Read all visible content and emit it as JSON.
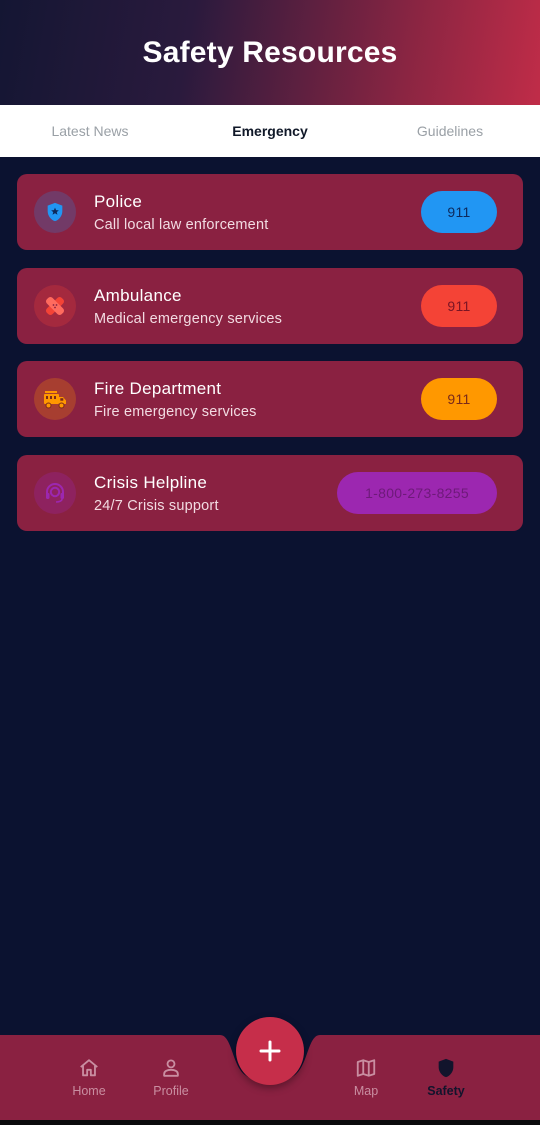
{
  "header": {
    "title": "Safety Resources"
  },
  "tabs": [
    {
      "label": "Latest News",
      "active": false
    },
    {
      "label": "Emergency",
      "active": true
    },
    {
      "label": "Guidelines",
      "active": false
    }
  ],
  "contacts": [
    {
      "title": "Police",
      "subtitle": "Call local law enforcement",
      "number": "911",
      "icon": "police-shield-icon",
      "color": "#2196f3"
    },
    {
      "title": "Ambulance",
      "subtitle": "Medical emergency services",
      "number": "911",
      "icon": "bandage-icon",
      "color": "#f44336"
    },
    {
      "title": "Fire Department",
      "subtitle": "Fire emergency services",
      "number": "911",
      "icon": "fire-truck-icon",
      "color": "#ff9800"
    },
    {
      "title": "Crisis Helpline",
      "subtitle": "24/7 Crisis support",
      "number": "1-800-273-8255",
      "icon": "support-agent-icon",
      "color": "#9c27b0"
    }
  ],
  "nav": [
    {
      "label": "Home",
      "icon": "home-icon",
      "active": false
    },
    {
      "label": "Profile",
      "icon": "person-icon",
      "active": false
    },
    {
      "label": "Map",
      "icon": "map-icon",
      "active": false
    },
    {
      "label": "Safety",
      "icon": "shield-icon",
      "active": true
    }
  ],
  "fab": {
    "icon": "plus-icon"
  },
  "colors": {
    "background": "#0b1230",
    "card": "#8a2141",
    "accent": "#c62e4a"
  }
}
